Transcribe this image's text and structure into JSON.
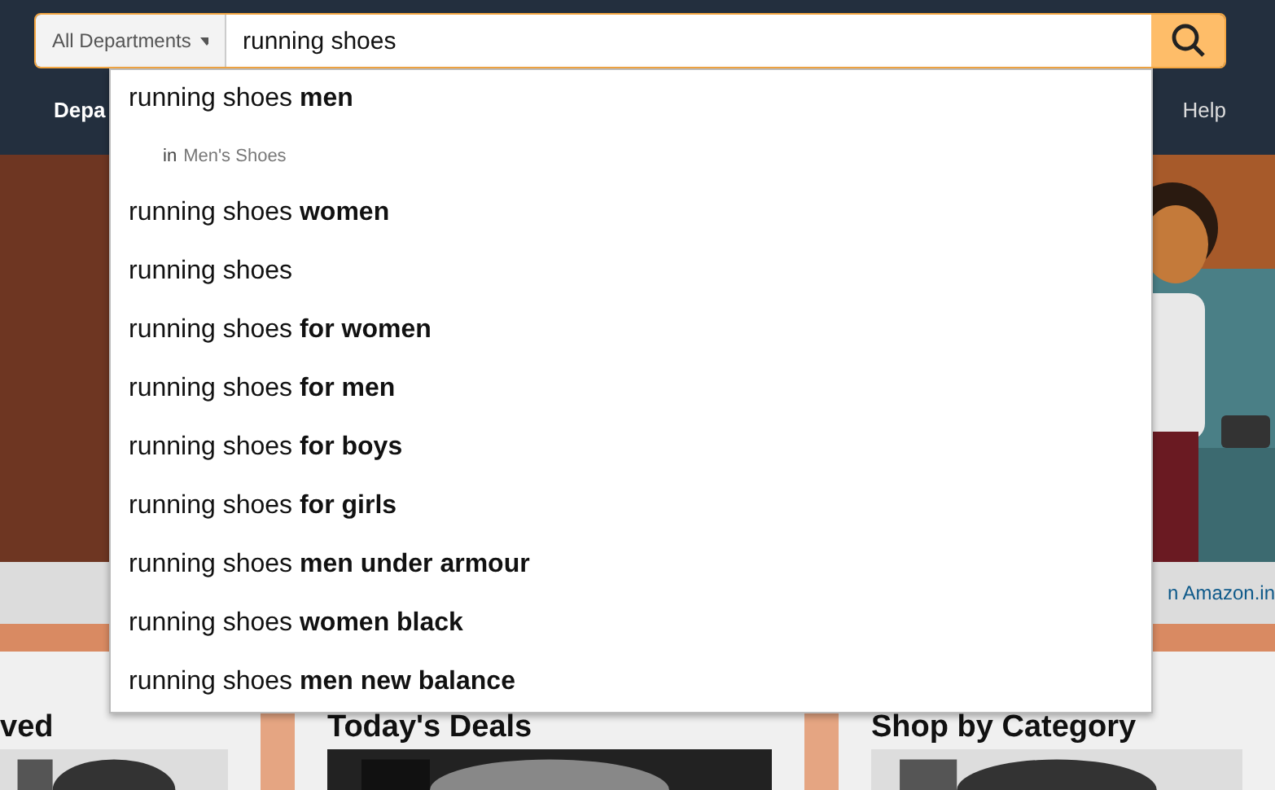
{
  "search": {
    "department": "All Departments",
    "value": "running shoes"
  },
  "nav": {
    "left": "Depa",
    "right": "Help"
  },
  "strip": {
    "link": "n Amazon.in"
  },
  "cards": [
    {
      "title": "ved"
    },
    {
      "title": "Today's Deals"
    },
    {
      "title": "Shop by Category"
    }
  ],
  "suggestions": [
    {
      "kind": "query",
      "text": "running shoes **men**"
    },
    {
      "kind": "department",
      "prefix": "in",
      "text": "Men's Shoes"
    },
    {
      "kind": "query",
      "text": "running shoes **women**"
    },
    {
      "kind": "query",
      "text": "running shoes"
    },
    {
      "kind": "query",
      "text": "running shoes **for women**"
    },
    {
      "kind": "query",
      "text": "running shoes **for men**"
    },
    {
      "kind": "query",
      "text": "running shoes **for boys**"
    },
    {
      "kind": "query",
      "text": "running shoes **for girls**"
    },
    {
      "kind": "query",
      "text": "running shoes **men under armour**"
    },
    {
      "kind": "query",
      "text": "running shoes **women black**"
    },
    {
      "kind": "query",
      "text": "running shoes **men new balance**"
    }
  ]
}
